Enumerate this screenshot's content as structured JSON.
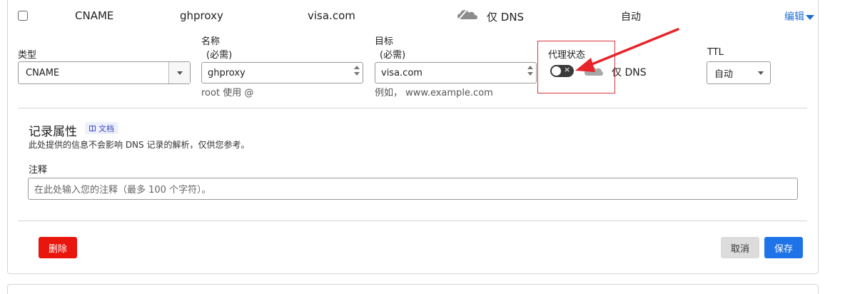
{
  "record_row": {
    "type": "CNAME",
    "name": "ghproxy",
    "target": "visa.com",
    "proxy_status": "仅 DNS",
    "ttl": "自动",
    "edit_label": "编辑"
  },
  "form": {
    "type_label": "类型",
    "type_value": "CNAME",
    "name_label": "名称",
    "name_required": "(必需)",
    "name_value": "ghproxy",
    "name_hint": "root 使用 @",
    "target_label": "目标",
    "target_required": "(必需)",
    "target_value": "visa.com",
    "target_hint": "例如， www.example.com",
    "proxy_label": "代理状态",
    "proxy_toggle_state": "off",
    "proxy_text": "仅 DNS",
    "ttl_label": "TTL",
    "ttl_value": "自动"
  },
  "record_attributes": {
    "title": "记录属性",
    "doc_badge": "文档",
    "description": "此处提供的信息不会影响 DNS 记录的解析，仅供您参考。",
    "comment_label": "注释",
    "comment_placeholder": "在此处输入您的注释（最多 100 个字符）。"
  },
  "actions": {
    "delete": "删除",
    "cancel": "取消",
    "save": "保存"
  },
  "colors": {
    "accent": "#1f73e8",
    "danger": "#e8160c",
    "annotation": "#d9343a"
  }
}
